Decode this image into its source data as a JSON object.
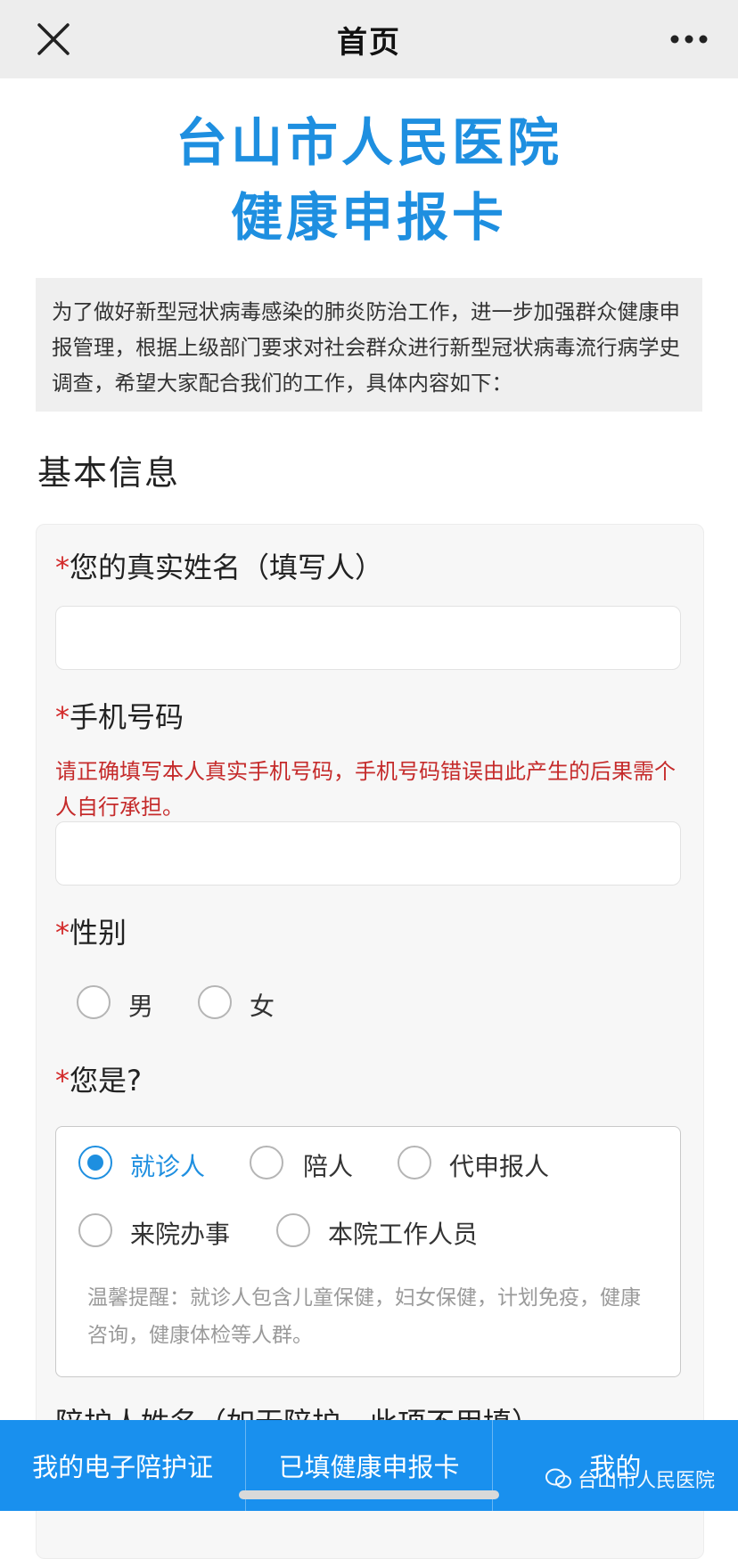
{
  "topbar": {
    "title": "首页"
  },
  "heading": {
    "line1": "台山市人民医院",
    "line2": "健康申报卡"
  },
  "intro": "为了做好新型冠状病毒感染的肺炎防治工作，进一步加强群众健康申报管理，根据上级部门要求对社会群众进行新型冠状病毒流行病学史调查，希望大家配合我们的工作，具体内容如下：",
  "section_title": "基本信息",
  "form": {
    "required_mark": "*",
    "name_label": "您的真实姓名（填写人）",
    "name_value": "",
    "phone_label": "手机号码",
    "phone_warning": "请正确填写本人真实手机号码，手机号码错误由此产生的后果需个人自行承担。",
    "phone_value": "",
    "gender_label": "性别",
    "gender_options": [
      "男",
      "女"
    ],
    "role_label": "您是?",
    "role_options": [
      "就诊人",
      "陪人",
      "代申报人",
      "来院办事",
      "本院工作人员"
    ],
    "role_selected": "就诊人",
    "role_tip": "温馨提醒：就诊人包含儿童保健，妇女保健，计划免疫，健康咨询，健康体检等人群。",
    "next_label_partial": "陪护人姓名（如无陪护，此项不用填）"
  },
  "bottom_tabs": [
    "我的电子陪护证",
    "已填健康申报卡",
    "我的"
  ],
  "watermark": "台山市人民医院",
  "colors": {
    "accent": "#1e8fe0",
    "warning": "#c52b2b",
    "bottom_bar": "#1990ee"
  }
}
